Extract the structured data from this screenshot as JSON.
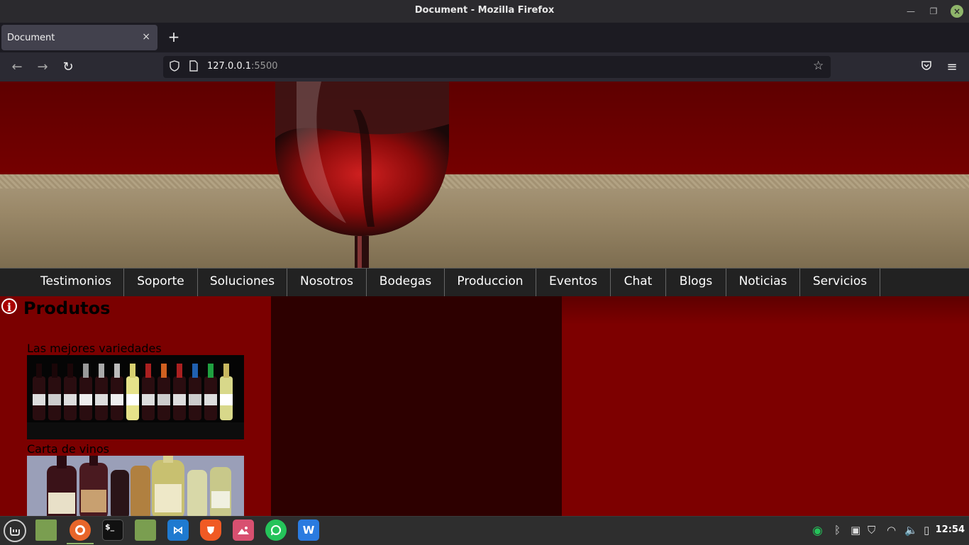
{
  "window": {
    "title": "Document - Mozilla Firefox"
  },
  "tab": {
    "title": "Document",
    "close": "×",
    "new_tab": "+"
  },
  "urlbar": {
    "host": "127.0.0.1",
    "port": ":5500"
  },
  "menu": [
    "Testimonios",
    "Soporte",
    "Soluciones",
    "Nosotros",
    "Bodegas",
    "Produccion",
    "Eventos",
    "Chat",
    "Blogs",
    "Noticias",
    "Servicios"
  ],
  "products": {
    "title": "Produtos",
    "items": [
      {
        "label": "Las mejores variedades"
      },
      {
        "label": "Carta de vinos"
      }
    ]
  },
  "taskbar": {
    "clock": "12:54",
    "apps": [
      "menu-icon",
      "show-desktop-icon",
      "firefox-icon",
      "terminal-icon",
      "files-icon",
      "vscode-icon",
      "brave-icon",
      "image-viewer-icon",
      "whatsapp-icon",
      "wps-office-icon"
    ]
  },
  "colors": {
    "banner_red": "#6e0000",
    "banner_beige": "#9a8868",
    "menu_bg": "#222222",
    "left_col": "#7b0000",
    "mid_col": "#2d0000",
    "taskbar_accent": "#8fb56a"
  }
}
